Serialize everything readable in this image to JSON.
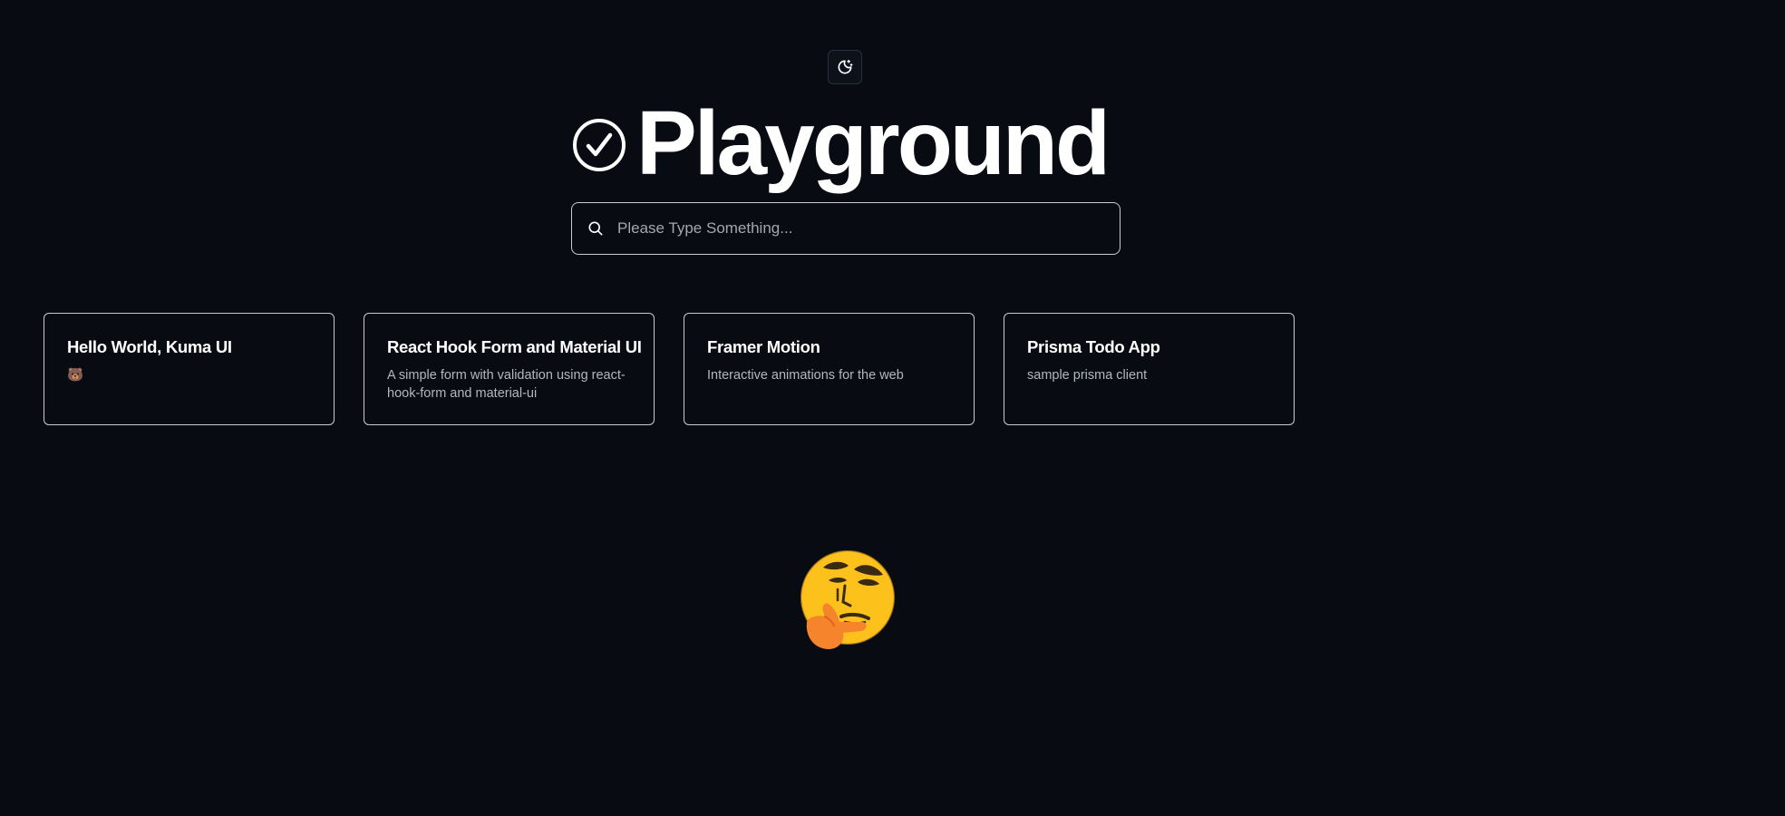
{
  "header": {
    "theme_toggle_icon": "moon-sparkle-icon",
    "title_icon": "check-circle-icon",
    "title": "Playground"
  },
  "search": {
    "placeholder": "Please Type Something...",
    "value": "",
    "icon": "search-icon"
  },
  "cards": [
    {
      "title": "Hello World, Kuma UI",
      "description": "🐻"
    },
    {
      "title": "React Hook Form and Material UI",
      "description": "A simple form with validation using react-hook-form and material-ui"
    },
    {
      "title": "Framer Motion",
      "description": "Interactive animations for the web"
    },
    {
      "title": "Prisma Todo App",
      "description": "sample prisma client"
    }
  ],
  "footer": {
    "illustration": "thinking-face-emoji"
  },
  "colors": {
    "background": "#080b12",
    "border": "#c9ccd3",
    "text": "#ffffff",
    "muted_text": "#b3b7bf"
  }
}
